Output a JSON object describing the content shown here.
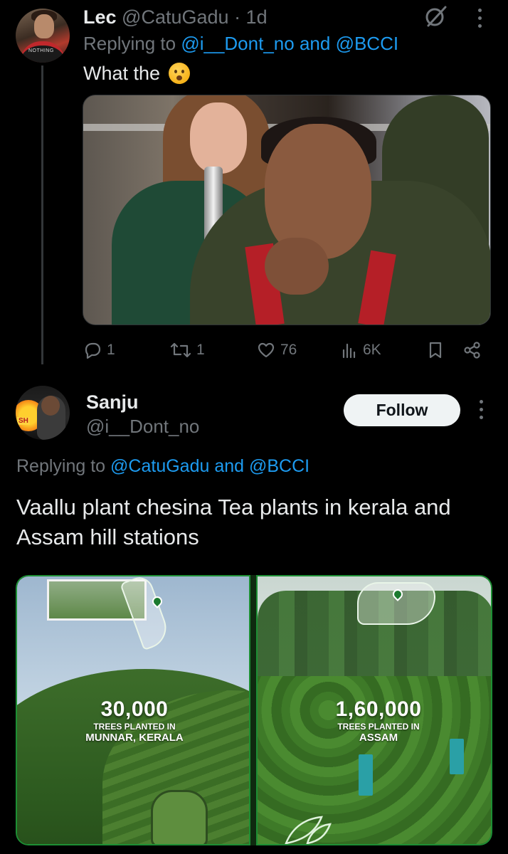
{
  "tweet1": {
    "name": "Lec",
    "handle": "@CatuGadu",
    "time": "· 1d",
    "replying_prefix": "Replying to",
    "replying_mention1": "@i__Dont_no",
    "replying_and": "and",
    "replying_mention2": "@BCCI",
    "text": "What the",
    "emoji": "astonished-face-emoji",
    "actions": {
      "replies": "1",
      "retweets": "1",
      "likes": "76",
      "views": "6K"
    }
  },
  "tweet2": {
    "name": "Sanju",
    "handle": "@i__Dont_no",
    "follow_label": "Follow",
    "replying_prefix": "Replying to",
    "replying_mention1": "@CatuGadu",
    "replying_and": "and",
    "replying_mention2": "@BCCI",
    "text": "Vaallu plant chesina Tea plants in kerala and Assam hill stations",
    "media": [
      {
        "number": "30,000",
        "label": "TREES PLANTED IN",
        "place": "MUNNAR, KERALA"
      },
      {
        "number": "1,60,000",
        "label": "TREES PLANTED IN",
        "place": "ASSAM"
      }
    ]
  },
  "colors": {
    "background": "#000000",
    "text": "#e7e9ea",
    "muted": "#71767b",
    "link": "#1d9bf0",
    "follow_bg": "#eff3f4",
    "media_border": "#1d8f34"
  }
}
